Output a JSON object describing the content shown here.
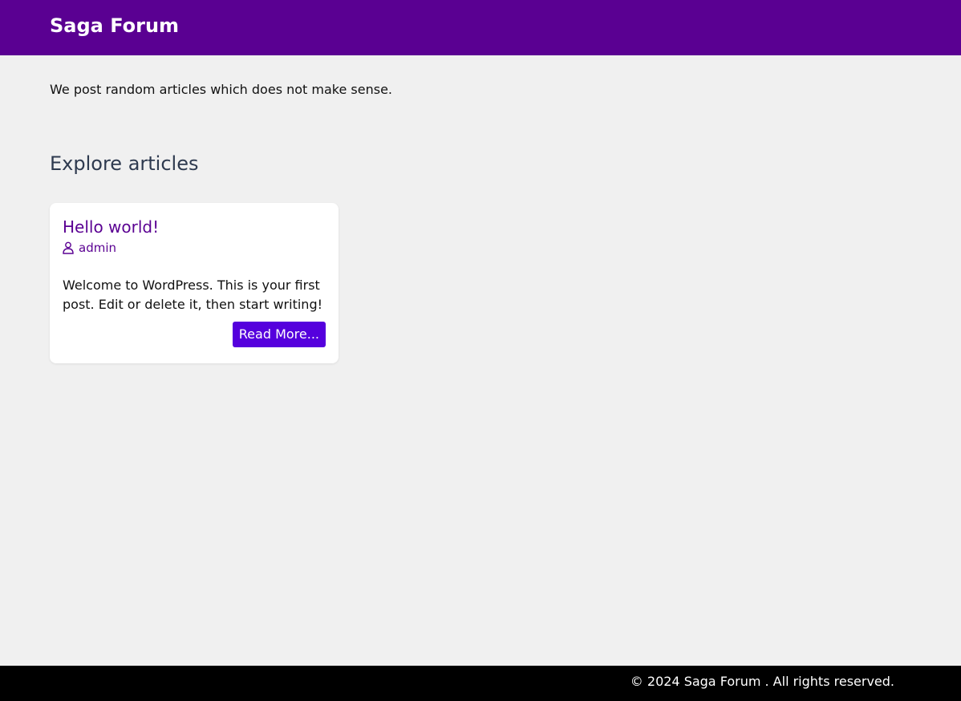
{
  "header": {
    "site_title": "Saga Forum"
  },
  "main": {
    "tagline": "We post random articles which does not make sense.",
    "section_heading": "Explore articles",
    "articles": [
      {
        "title": "Hello world!",
        "author_icon": "user-icon",
        "author": "admin",
        "excerpt": "Welcome to WordPress. This is your first post. Edit or delete it, then start writing!",
        "read_more_label": "Read More..."
      }
    ]
  },
  "footer": {
    "copyright": "© 2024 Saga Forum . All rights reserved."
  },
  "colors": {
    "header_bg": "#5a0092",
    "accent": "#5a0092",
    "button_bg": "#5500dd",
    "page_bg": "#f0f0f0",
    "footer_bg": "#000000"
  }
}
